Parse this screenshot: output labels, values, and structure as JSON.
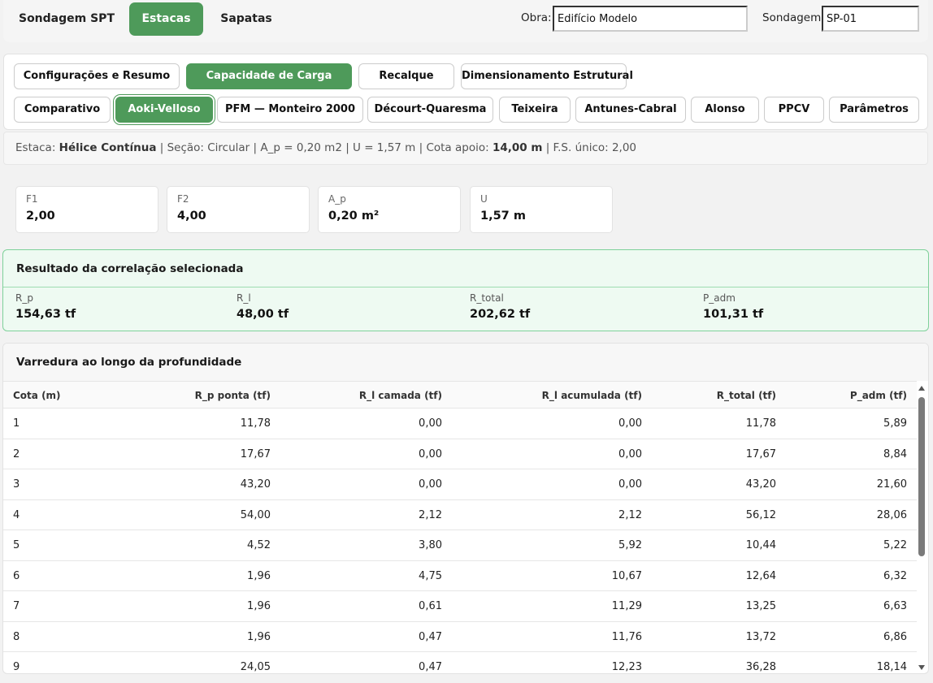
{
  "main_tabs": [
    {
      "label": "Sondagem SPT",
      "active": false
    },
    {
      "label": "Estacas",
      "active": true
    },
    {
      "label": "Sapatas",
      "active": false
    }
  ],
  "obra": {
    "label": "Obra:",
    "value": "Edifício Modelo"
  },
  "sondagem": {
    "label": "Sondagem:",
    "value": "SP-01"
  },
  "section_tabs": [
    {
      "label": "Configurações e Resumo",
      "active": false
    },
    {
      "label": "Capacidade de Carga",
      "active": true
    },
    {
      "label": "Recalque",
      "active": false
    },
    {
      "label": "Dimensionamento Estrutural",
      "active": false
    }
  ],
  "method_tabs": [
    {
      "label": "Comparativo",
      "active": false
    },
    {
      "label": "Aoki-Velloso",
      "active": true
    },
    {
      "label": "PFM — Monteiro 2000",
      "active": false
    },
    {
      "label": "Décourt-Quaresma",
      "active": false
    },
    {
      "label": "Teixeira",
      "active": false
    },
    {
      "label": "Antunes-Cabral",
      "active": false
    },
    {
      "label": "Alonso",
      "active": false
    },
    {
      "label": "PPCV",
      "active": false
    },
    {
      "label": "Parâmetros",
      "active": false
    }
  ],
  "info": {
    "estaca_prefix": "Estaca: ",
    "estaca": "Hélice Contínua",
    "middle": " | Seção: Circular | A_p = 0,20 m2 | U = 1,57 m | Cota apoio: ",
    "cota": "14,00 m",
    "suffix": " | F.S. único: 2,00"
  },
  "params": [
    {
      "label": "F1",
      "value": "2,00"
    },
    {
      "label": "F2",
      "value": "4,00"
    },
    {
      "label": "A_p",
      "value": "0,20 m²"
    },
    {
      "label": "U",
      "value": "1,57 m"
    }
  ],
  "result": {
    "title": "Resultado da correlação selecionada",
    "items": [
      {
        "label": "R_p",
        "value": "154,63 tf"
      },
      {
        "label": "R_l",
        "value": "48,00 tf"
      },
      {
        "label": "R_total",
        "value": "202,62 tf"
      },
      {
        "label": "P_adm",
        "value": "101,31 tf"
      }
    ]
  },
  "sweep": {
    "title": "Varredura ao longo da profundidade",
    "columns": [
      "Cota (m)",
      "R_p ponta (tf)",
      "R_l camada (tf)",
      "R_l acumulada (tf)",
      "R_total (tf)",
      "P_adm (tf)"
    ],
    "rows": [
      [
        "1",
        "11,78",
        "0,00",
        "0,00",
        "11,78",
        "5,89"
      ],
      [
        "2",
        "17,67",
        "0,00",
        "0,00",
        "17,67",
        "8,84"
      ],
      [
        "3",
        "43,20",
        "0,00",
        "0,00",
        "43,20",
        "21,60"
      ],
      [
        "4",
        "54,00",
        "2,12",
        "2,12",
        "56,12",
        "28,06"
      ],
      [
        "5",
        "4,52",
        "3,80",
        "5,92",
        "10,44",
        "5,22"
      ],
      [
        "6",
        "1,96",
        "4,75",
        "10,67",
        "12,64",
        "6,32"
      ],
      [
        "7",
        "1,96",
        "0,61",
        "11,29",
        "13,25",
        "6,63"
      ],
      [
        "8",
        "1,96",
        "0,47",
        "11,76",
        "13,72",
        "6,86"
      ],
      [
        "9",
        "24,05",
        "0,47",
        "12,23",
        "36,28",
        "18,14"
      ]
    ]
  },
  "colors": {
    "accent": "#4e9a5a",
    "result_bg": "#eefaf2",
    "result_border": "#7fd19a"
  }
}
